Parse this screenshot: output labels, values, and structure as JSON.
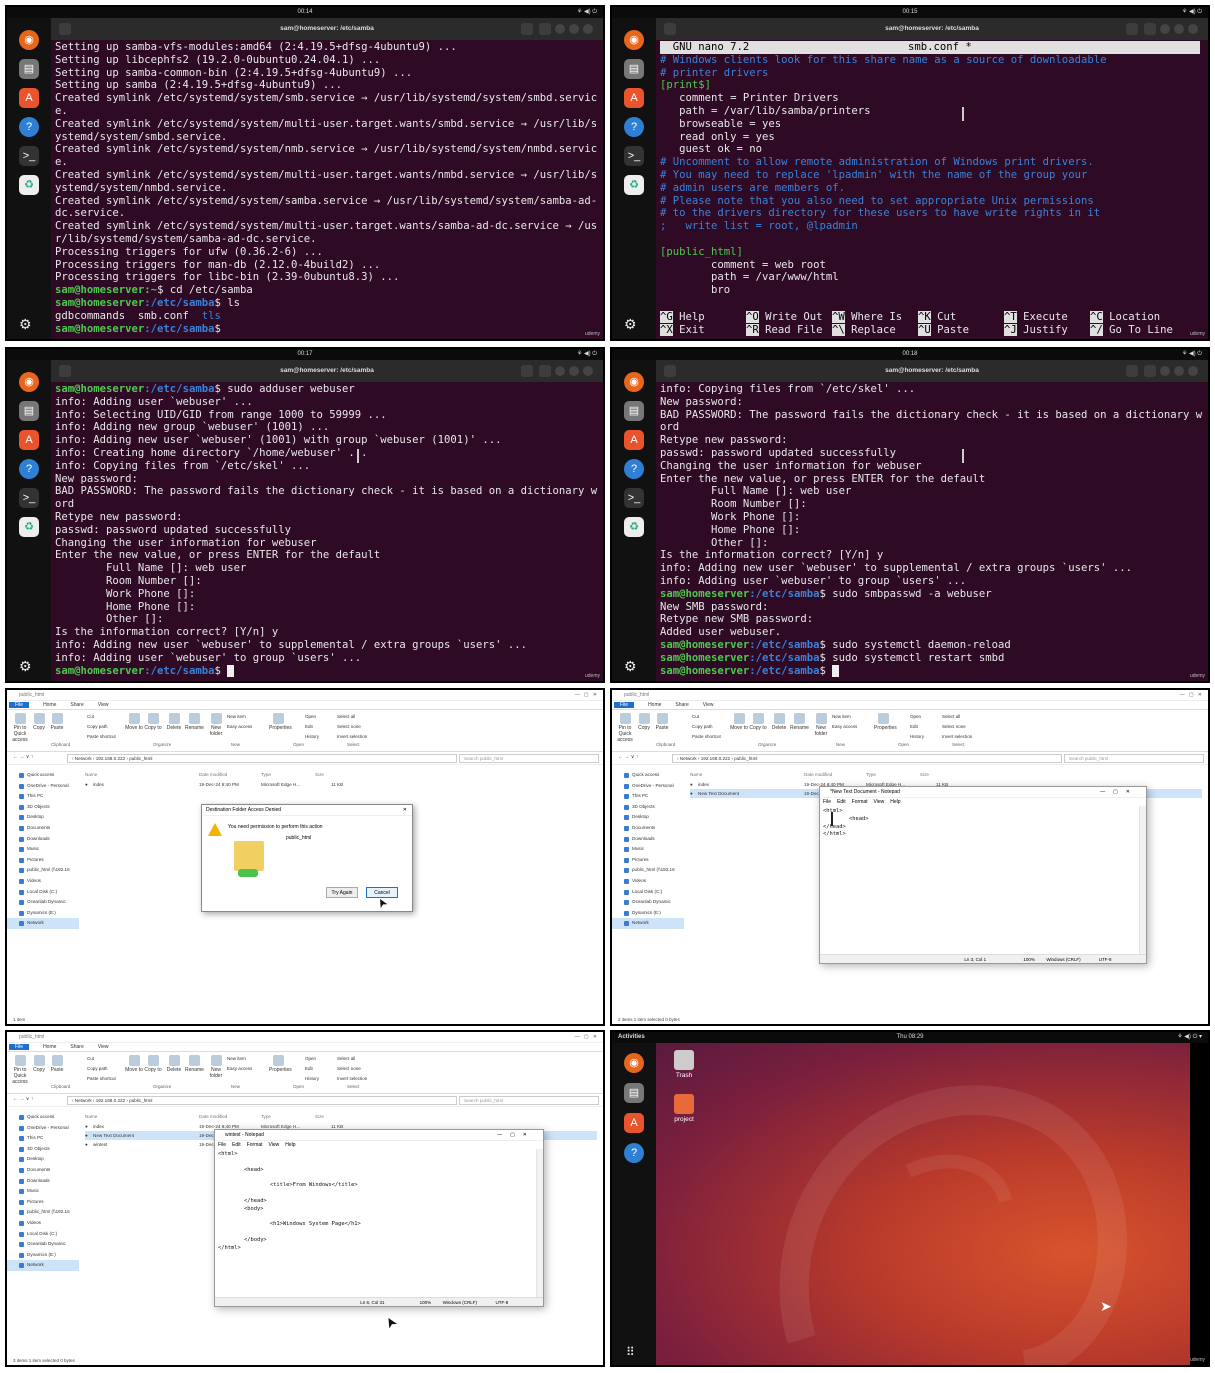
{
  "panel1": {
    "clock": "00:14",
    "window_title": "sam@homeserver: /etc/samba",
    "lines": [
      "Setting up samba-vfs-modules:amd64 (2:4.19.5+dfsg-4ubuntu9) ...",
      "Setting up libcephfs2 (19.2.0-0ubuntu0.24.04.1) ...",
      "Setting up samba-common-bin (2:4.19.5+dfsg-4ubuntu9) ...",
      "Setting up samba (2:4.19.5+dfsg-4ubuntu9) ...",
      "Created symlink /etc/systemd/system/smb.service → /usr/lib/systemd/system/smbd.servic",
      "e.",
      "Created symlink /etc/systemd/system/multi-user.target.wants/smbd.service → /usr/lib/s",
      "ystemd/system/smbd.service.",
      "Created symlink /etc/systemd/system/nmb.service → /usr/lib/systemd/system/nmbd.servic",
      "e.",
      "Created symlink /etc/systemd/system/multi-user.target.wants/nmbd.service → /usr/lib/s",
      "ystemd/system/nmbd.service.",
      "Created symlink /etc/systemd/system/samba.service → /usr/lib/systemd/system/samba-ad-",
      "dc.service.",
      "Created symlink /etc/systemd/system/multi-user.target.wants/samba-ad-dc.service → /us",
      "r/lib/systemd/system/samba-ad-dc.service.",
      "Processing triggers for ufw (0.36.2-6) ...",
      "Processing triggers for man-db (2.12.0-4build2) ...",
      "Processing triggers for libc-bin (2.39-0ubuntu8.3) ..."
    ],
    "prompt_user": "sam@homeserver",
    "prompt_home": ":~",
    "prompt_path": ":/etc/samba",
    "cmd1": "$ cd /etc/samba",
    "cmd2": "$ ls",
    "ls_out": "gdbcommands  smb.conf  ",
    "ls_dir": "tls",
    "cmd3": "$"
  },
  "panel2": {
    "clock": "00:15",
    "window_title": "sam@homeserver: /etc/samba",
    "nano_left": "  GNU nano 7.2",
    "nano_file": "smb.conf *",
    "lines_comment1": [
      "# Windows clients look for this share name as a source of downloadable",
      "# printer drivers"
    ],
    "section1": "[print$]",
    "lines_body1": [
      "   comment = Printer Drivers",
      "   path = /var/lib/samba/printers",
      "   browseable = yes",
      "   read only = yes",
      "   guest ok = no"
    ],
    "lines_comment2": [
      "# Uncomment to allow remote administration of Windows print drivers.",
      "# You may need to replace 'lpadmin' with the name of the group your",
      "# admin users are members of.",
      "# Please note that you also need to set appropriate Unix permissions",
      "# to the drivers directory for these users to have write rights in it",
      ";   write list = root, @lpadmin"
    ],
    "section2": "[public_html]",
    "lines_body2": [
      "        comment = web root",
      "        path = /var/www/html",
      "        bro"
    ],
    "shortcuts": [
      {
        "k1": "^G",
        "l1": "Help",
        "k2": "^X",
        "l2": "Exit"
      },
      {
        "k1": "^O",
        "l1": "Write Out",
        "k2": "^R",
        "l2": "Read File"
      },
      {
        "k1": "^W",
        "l1": "Where Is",
        "k2": "^\\",
        "l2": "Replace"
      },
      {
        "k1": "^K",
        "l1": "Cut",
        "k2": "^U",
        "l2": "Paste"
      },
      {
        "k1": "^T",
        "l1": "Execute",
        "k2": "^J",
        "l2": "Justify"
      },
      {
        "k1": "^C",
        "l1": "Location",
        "k2": "^/",
        "l2": "Go To Line"
      }
    ]
  },
  "panel3": {
    "clock": "00:17",
    "window_title": "sam@homeserver: /etc/samba",
    "first_cmd": "$ sudo adduser webuser",
    "lines": [
      "info: Adding user `webuser' ...",
      "info: Selecting UID/GID from range 1000 to 59999 ...",
      "info: Adding new group `webuser' (1001) ...",
      "info: Adding new user `webuser' (1001) with group `webuser (1001)' ...",
      "info: Creating home directory `/home/webuser' ...",
      "info: Copying files from `/etc/skel' ...",
      "New password:",
      "BAD PASSWORD: The password fails the dictionary check - it is based on a dictionary w",
      "ord",
      "Retype new password:",
      "passwd: password updated successfully",
      "Changing the user information for webuser",
      "Enter the new value, or press ENTER for the default",
      "        Full Name []: web user",
      "        Room Number []:",
      "        Work Phone []:",
      "        Home Phone []:",
      "        Other []:",
      "Is the information correct? [Y/n] y",
      "info: Adding new user `webuser' to supplemental / extra groups `users' ...",
      "info: Adding user `webuser' to group `users' ..."
    ],
    "last_cmd": "$ "
  },
  "panel4": {
    "clock": "00:18",
    "window_title": "sam@homeserver: /etc/samba",
    "lines": [
      "info: Copying files from `/etc/skel' ...",
      "New password:",
      "BAD PASSWORD: The password fails the dictionary check - it is based on a dictionary w",
      "ord",
      "Retype new password:",
      "passwd: password updated successfully",
      "Changing the user information for webuser",
      "Enter the new value, or press ENTER for the default",
      "        Full Name []: web user",
      "        Room Number []:",
      "        Work Phone []:",
      "        Home Phone []:",
      "        Other []:",
      "Is the information correct? [Y/n] y",
      "info: Adding new user `webuser' to supplemental / extra groups `users' ...",
      "info: Adding user `webuser' to group `users' ..."
    ],
    "cmd_smbpasswd": "$ sudo smbpasswd -a webuser",
    "lines2": [
      "New SMB password:",
      "Retype new SMB password:",
      "Added user webuser."
    ],
    "cmd_reload": "$ sudo systemctl daemon-reload",
    "cmd_restart": "$ sudo systemctl restart smbd",
    "cmd_last": "$ "
  },
  "explorer": {
    "title": "public_html",
    "menu": [
      "File",
      "Home",
      "Share",
      "View"
    ],
    "ribbon_groups": [
      "Clipboard",
      "Organize",
      "New",
      "Open",
      "Select"
    ],
    "ribbon_buttons": [
      "Pin to Quick access",
      "Copy",
      "Paste",
      "Move to",
      "Copy to",
      "Delete",
      "Rename",
      "New folder",
      "Properties"
    ],
    "ribbon_small": [
      "Cut",
      "Copy path",
      "Paste shortcut",
      "New item",
      "Easy access",
      "Open",
      "Edit",
      "History",
      "Select all",
      "Select none",
      "Invert selection"
    ],
    "address": "›  Network  ›  192.168.0.222  ›  public_html",
    "search_placeholder": "Search public_html",
    "nav": [
      "Quick access",
      "OneDrive - Personal",
      "This PC",
      "3D Objects",
      "Desktop",
      "Documents",
      "Downloads",
      "Music",
      "Pictures",
      "public_html (\\\\192.16",
      "Videos",
      "Local Disk (C:)",
      "Oceanlab Dynamic",
      "Dynamics (E:)",
      "Network"
    ],
    "columns": [
      "Name",
      "Date modified",
      "Type",
      "Size"
    ]
  },
  "panel5": {
    "rows": [
      {
        "name": "index",
        "date": "19-Dec-24 6:40 PM",
        "type": "Microsoft Edge H...",
        "size": "11 KB"
      }
    ],
    "status": "1 item",
    "dialog_title": "Destination Folder Access Denied",
    "dialog_msg": "You need permission to perform this action",
    "dialog_folder": "public_html",
    "try_again": "Try Again",
    "cancel": "Cancel"
  },
  "panel6": {
    "rows": [
      {
        "name": "index",
        "date": "19-Dec-24 6:40 PM",
        "type": "Microsoft Edge H...",
        "size": "11 KB"
      },
      {
        "name": "New Text Document",
        "date": "19-Dec",
        "type": "",
        "size": ""
      }
    ],
    "status": "2 items    1 item selected  0 bytes",
    "np_title": "*New Text Document - Notepad",
    "np_menu": [
      "File",
      "Edit",
      "Format",
      "View",
      "Help"
    ],
    "np_text": "<html>\n        <head>\n</head>\n</html>",
    "np_status": [
      "Ln 3, Col 1",
      "100%",
      "Windows (CRLF)",
      "UTF-8"
    ]
  },
  "panel7": {
    "rows": [
      {
        "name": "index",
        "date": "19-Dec-24 6:40 PM",
        "type": "Microsoft Edge H...",
        "size": "11 KB"
      },
      {
        "name": "New Text Document",
        "date": "19-Dec",
        "type": "",
        "size": ""
      },
      {
        "name": "wintest",
        "date": "19-Dec",
        "type": "",
        "size": ""
      }
    ],
    "status": "3 items    1 item selected  0 bytes",
    "np_title": "wintest - Notepad",
    "np_menu": [
      "File",
      "Edit",
      "Format",
      "View",
      "Help"
    ],
    "np_text": "<html>\n\n        <head>\n\n                <title>From Windows</title>\n\n        </head>\n        <body>\n\n                <h1>Windows System Page</h1>\n\n        </body>\n</html>",
    "np_status": [
      "Ln 6, Col 31",
      "100%",
      "Windows (CRLF)",
      "UTF-8"
    ]
  },
  "panel8": {
    "activities": "Activities",
    "clock": "Thu 08:29",
    "icons": [
      {
        "label": "Trash"
      },
      {
        "label": "project"
      }
    ]
  },
  "udemy": "udemy",
  "colors": {
    "terminal_bg": "#2e0a24",
    "prompt_green": "#4ec94e",
    "path_blue": "#3b82d9",
    "win_blue": "#1e6fd0"
  }
}
